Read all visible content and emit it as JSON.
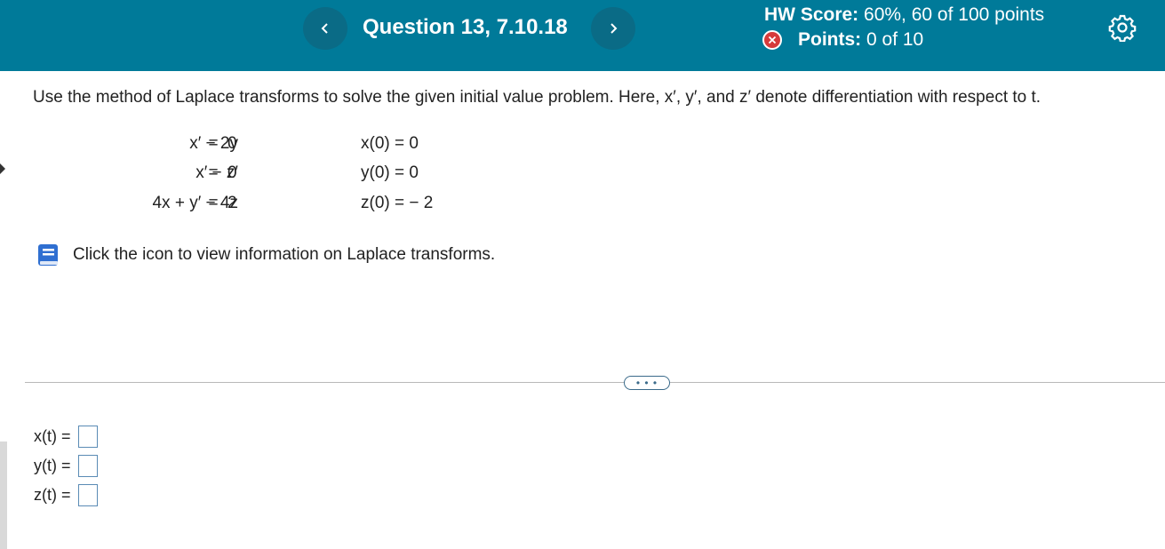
{
  "header": {
    "question_title": "Question 13, 7.10.18",
    "hw_score_label": "HW Score:",
    "hw_score_value": "60%, 60 of 100 points",
    "points_label": "Points:",
    "points_value": "0 of 10",
    "prev_icon": "chevron-left-icon",
    "next_icon": "chevron-right-icon",
    "settings_icon": "gear-icon",
    "status_icon": "x-circle-icon"
  },
  "problem": {
    "prompt": "Use the method of Laplace transforms to solve the given initial value problem. Here, x′, y′, and z′ denote differentiation with respect to t.",
    "equations": [
      {
        "lhs": "x′ − 2y",
        "rel": "=",
        "rhs": "0",
        "ic": "x(0) = 0"
      },
      {
        "lhs": "x′ − z′",
        "rel": "=",
        "rhs": "0",
        "ic": "y(0) = 0"
      },
      {
        "lhs": "4x + y′ − 4z",
        "rel": "=",
        "rhs": "2",
        "ic": "z(0) = − 2"
      }
    ],
    "info_text": "Click the icon to view information on Laplace transforms.",
    "info_icon": "book-icon"
  },
  "more_button": "• • •",
  "answers": [
    {
      "label": "x(t) =",
      "value": ""
    },
    {
      "label": "y(t) =",
      "value": ""
    },
    {
      "label": "z(t) =",
      "value": ""
    }
  ],
  "colors": {
    "header_bg": "#007a99",
    "nav_button_bg": "#0a6b86",
    "error_red": "#d63b3b",
    "input_border": "#5a8bb5"
  }
}
